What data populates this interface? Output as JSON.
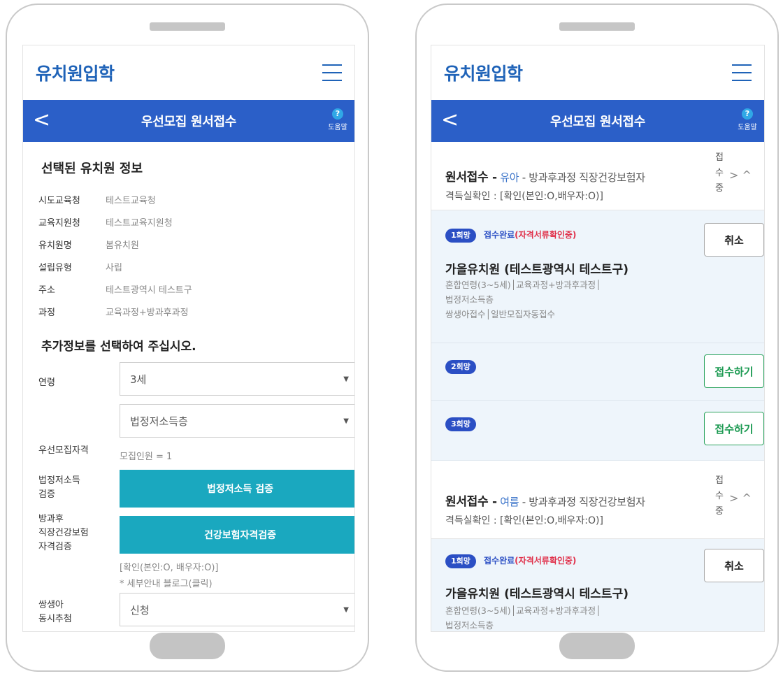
{
  "left": {
    "brand": "유치원입학",
    "title": "우선모집 원서접수",
    "help_label": "도움말",
    "help_q": "?",
    "back": "<",
    "section_title": "선택된 유치원 정보",
    "info": [
      {
        "k": "시도교육청",
        "v": "테스트교육청"
      },
      {
        "k": "교육지원청",
        "v": "테스트교육지원청"
      },
      {
        "k": "유치원명",
        "v": "봄유치원"
      },
      {
        "k": "설립유형",
        "v": "사립"
      },
      {
        "k": "주소",
        "v": "테스트광역시 테스트구"
      },
      {
        "k": "과정",
        "v": "교육과정+방과후과정"
      }
    ],
    "section2": "추가정보를 선택하여 주십시오.",
    "age_label": "연령",
    "age_value": "3세",
    "priority_label": "우선모집자격",
    "priority_value": "법정저소득층",
    "recruit_count": "모집인원 = 1",
    "lowincome_label1": "법정저소득",
    "lowincome_label2": "검증",
    "lowincome_btn": "법정저소득 검증",
    "afterschool_label1": "방과후",
    "afterschool_label2": "직장건강보험",
    "afterschool_label3": "자격검증",
    "health_btn": "건강보험자격검증",
    "confirm_text": "[확인(본인:O, 배우자:O)]",
    "blog_text": "* 세부안내 블로그(클릭)",
    "twins_label1": "쌍생아",
    "twins_label2": "동시추첨",
    "twins_value": "신청",
    "caret": "▼"
  },
  "right": {
    "brand": "유치원입학",
    "title": "우선모집 원서접수",
    "help_label": "도움말",
    "help_q": "?",
    "back": "<",
    "blocks": [
      {
        "head_bold": "원서접수 -",
        "kid": "유아",
        "head_rest": "- 방과후과정 직장건강보험자",
        "head_line2": "격득실확인 : [확인(본인:O,배우자:O)]",
        "status": [
          "접",
          "수",
          "중"
        ],
        "arrows": ">  ^"
      },
      {
        "head_bold": "원서접수 -",
        "kid": "여름",
        "head_rest": "- 방과후과정 직장건강보험자",
        "head_line2": "격득실확인 : [확인(본인:O,배우자:O)]",
        "status": [
          "접",
          "수",
          "중"
        ],
        "arrows": ">  ^"
      }
    ],
    "choice1_pill": "1희망",
    "choice1_status": "접수완료",
    "choice1_status_red": "(자격서류확인중)",
    "cancel": "취소",
    "kname": "가을유치원 (테스트광역시 테스트구)",
    "kdet1": "혼합연령(3~5세)│교육과정+방과후과정│",
    "kdet2": "법정저소득층",
    "kdet3": "쌍생아접수│일반모집자동접수",
    "choice2_pill": "2희망",
    "choice3_pill": "3희망",
    "apply": "접수하기",
    "kdet2b": "법정저소득층"
  }
}
